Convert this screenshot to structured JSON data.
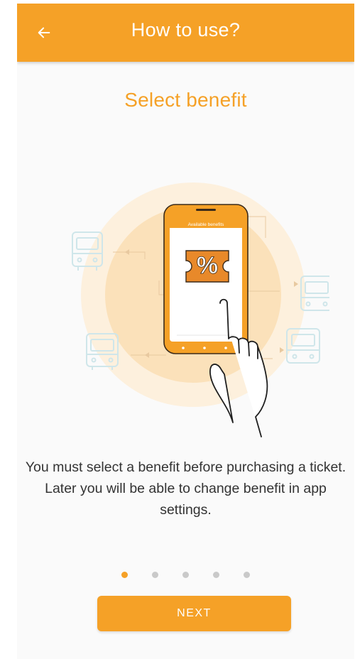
{
  "app_bar": {
    "title": "How to use?",
    "back_icon": "arrow-left-icon"
  },
  "step": {
    "title": "Select benefit",
    "description": "You must select a benefit before purchasing a ticket. Later you will be able to change benefit in app settings."
  },
  "illustration": {
    "phone_header_text": "Available benefits",
    "coupon_symbol": "%",
    "icons": [
      "bus-icon",
      "phone-icon",
      "discount-coupon-icon",
      "pointing-hand-icon"
    ]
  },
  "pagination": {
    "total": 5,
    "active_index": 0
  },
  "actions": {
    "next_label": "NEXT"
  },
  "colors": {
    "primary": "#f5a127",
    "halo_outer": "#fdf0dd",
    "halo_inner": "#fbe1ba",
    "bus_outline": "#cfe6ea",
    "text": "#333333",
    "dot_inactive": "#c9c9c9"
  }
}
